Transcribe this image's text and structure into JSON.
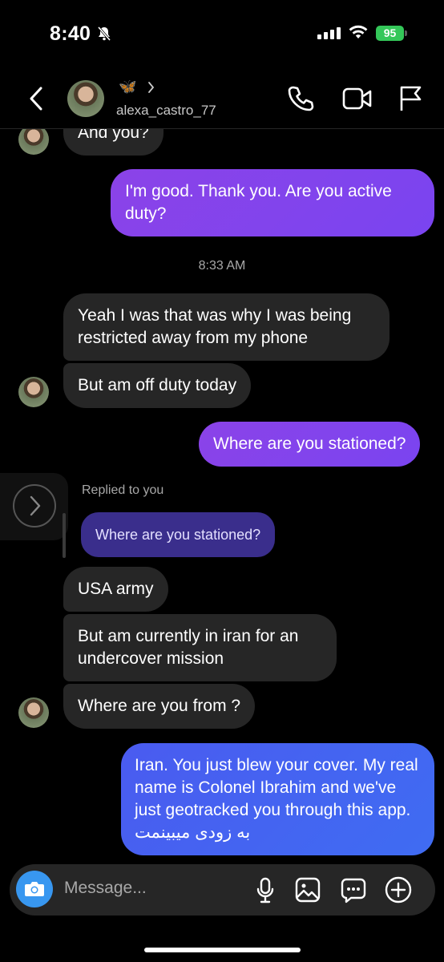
{
  "status_bar": {
    "time": "8:40",
    "battery": "95"
  },
  "header": {
    "username": "alexa_castro_77",
    "emoji": "🦋"
  },
  "messages": {
    "m0": "And you?",
    "m1": "I'm good. Thank you. Are you active duty?",
    "timestamp": "8:33 AM",
    "m2": "Yeah I was that was why I was being restricted away from my phone",
    "m3": "But am off duty today",
    "m4": "Where are you stationed?",
    "replied_label": "Replied to you",
    "quoted": "Where are you stationed?",
    "m5": "USA army",
    "m6": "But am currently in iran for an undercover mission",
    "m7": "Where are you from ?",
    "m8": "Iran. You just blew your cover.  My real name is Colonel Ibrahim and we've just geotracked you through this app. به زودی میبینمت"
  },
  "composer": {
    "placeholder": "Message..."
  },
  "colors": {
    "accent_purple": "#8b43e8",
    "accent_blue": "#3f6cf2",
    "incoming": "#262626",
    "camera": "#3897f0"
  },
  "icons": [
    "bell-slash-icon",
    "signal-icon",
    "wifi-icon",
    "back-chevron-icon",
    "phone-icon",
    "video-icon",
    "flag-icon",
    "share-chevron-icon",
    "camera-icon",
    "microphone-icon",
    "gallery-icon",
    "sticker-icon",
    "plus-icon"
  ]
}
